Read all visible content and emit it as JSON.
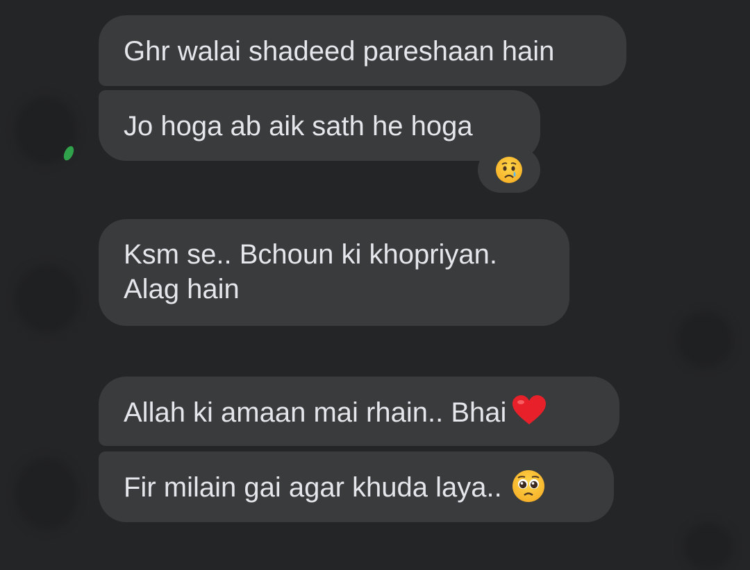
{
  "messages": [
    {
      "text": "Ghr walai shadeed pareshaan hain"
    },
    {
      "text": "Jo hoga ab aik sath he hoga",
      "reaction": "sad-tear-emoji"
    },
    {
      "line1": "Ksm se.. Bchoun ki khopriyan.",
      "line2": "Alag hain"
    },
    {
      "text": "Allah ki amaan mai rhain.. Bhai",
      "emoji": "red-heart-emoji"
    },
    {
      "text": "Fir milain gai agar khuda laya..",
      "emoji": "pleading-face-emoji"
    }
  ],
  "colors": {
    "background": "#242526",
    "bubble": "#3a3b3c",
    "text": "#e4e6eb",
    "online": "#31a24c",
    "heart": "#e8202a"
  }
}
